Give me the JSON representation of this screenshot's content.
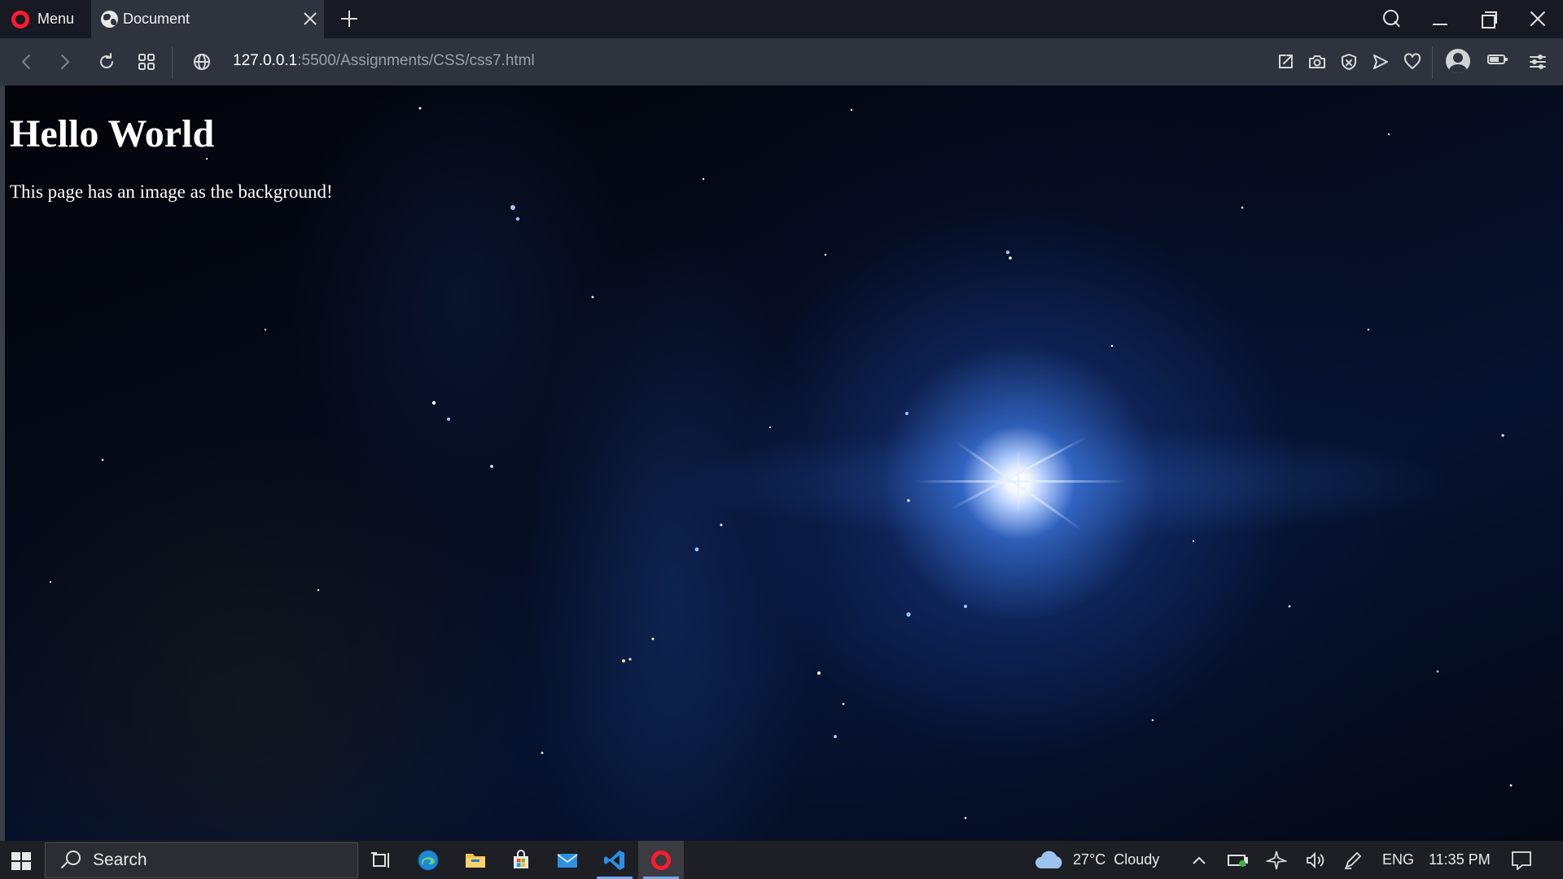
{
  "browser": {
    "menu_label": "Menu",
    "tab_title": "Document",
    "url_host": "127.0.0.1",
    "url_path": ":5500/Assignments/CSS/css7.html"
  },
  "page": {
    "heading": "Hello World",
    "paragraph": "This page has an image as the background!"
  },
  "taskbar": {
    "search_placeholder": "Search",
    "weather_temp": "27°C",
    "weather_desc": "Cloudy",
    "language": "ENG",
    "time": "11:35 PM"
  },
  "colors": {
    "opera_red": "#ff1b2d",
    "tab_active": "#2e333d",
    "titlebar": "#171a22",
    "taskbar": "#1d1f24"
  }
}
